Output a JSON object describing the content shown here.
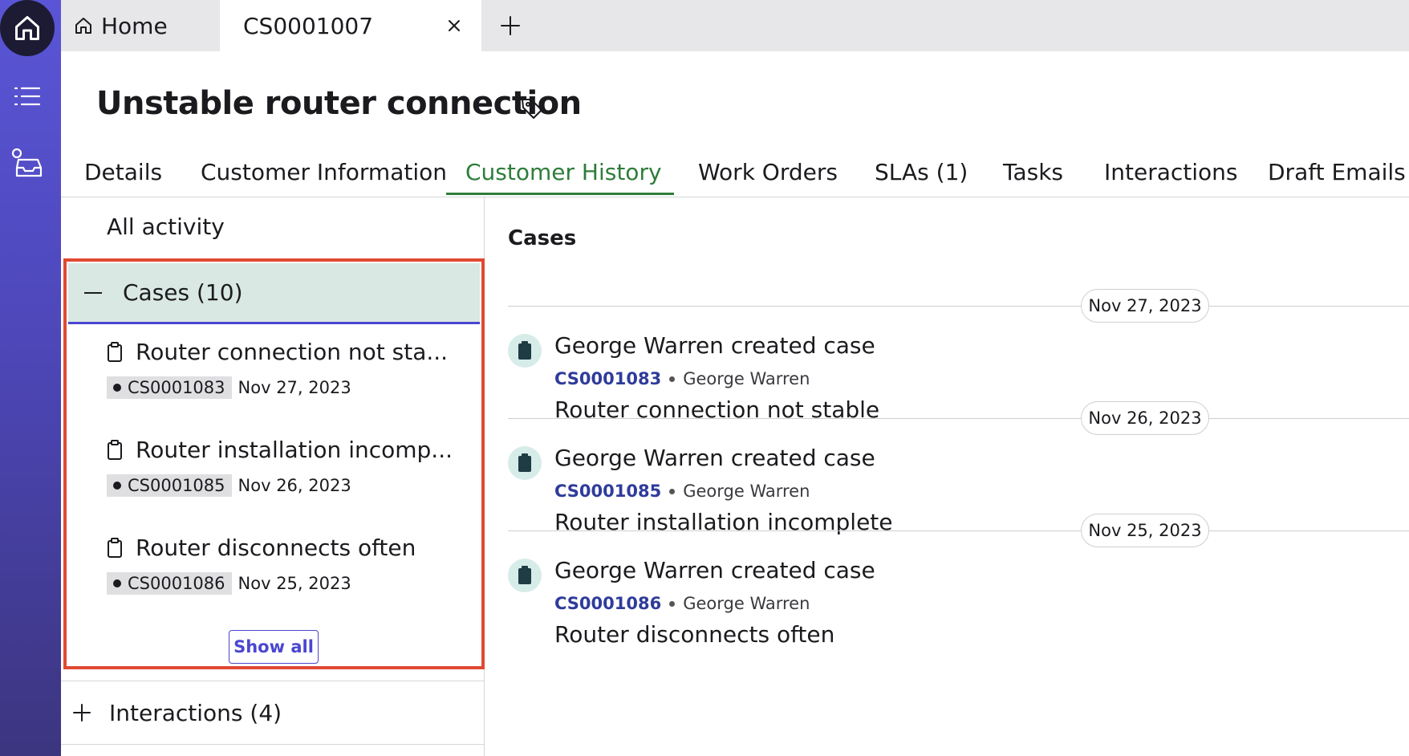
{
  "tabs": {
    "home_label": "Home",
    "active_label": "CS0001007"
  },
  "record": {
    "title": "Unstable router connection",
    "tabs": [
      "Details",
      "Customer Information",
      "Customer History",
      "Work Orders",
      "SLAs (1)",
      "Tasks",
      "Interactions",
      "Draft Emails"
    ],
    "active_tab": "Customer History"
  },
  "left_pane": {
    "all_activity": "All activity",
    "cases_header": "Cases (10)",
    "cases": [
      {
        "title": "Router connection not sta...",
        "number": "CS0001083",
        "date": "Nov 27, 2023"
      },
      {
        "title": "Router installation incomp...",
        "number": "CS0001085",
        "date": "Nov 26, 2023"
      },
      {
        "title": "Router disconnects often",
        "number": "CS0001086",
        "date": "Nov 25, 2023"
      }
    ],
    "show_all": "Show all",
    "interactions_header": "Interactions (4)"
  },
  "right_pane": {
    "title": "Cases",
    "entries": [
      {
        "date": "Nov 27, 2023",
        "title": "George Warren created case",
        "number": "CS0001083",
        "by": "George Warren",
        "description": "Router connection not stable"
      },
      {
        "date": "Nov 26, 2023",
        "title": "George Warren created case",
        "number": "CS0001085",
        "by": "George Warren",
        "description": "Router installation incomplete"
      },
      {
        "date": "Nov 25, 2023",
        "title": "George Warren created case",
        "number": "CS0001086",
        "by": "George Warren",
        "description": "Router disconnects often"
      }
    ]
  },
  "colors": {
    "rail": "#4d47b9",
    "accent_green": "#2e7d3a",
    "highlight_border": "#e04a32",
    "link_blue": "#2f3c9a"
  },
  "icons": {
    "rail_home": "home-icon",
    "rail_list": "list-icon",
    "rail_inbox": "inbox-icon",
    "tag": "tag-icon",
    "case": "clipboard-icon"
  }
}
